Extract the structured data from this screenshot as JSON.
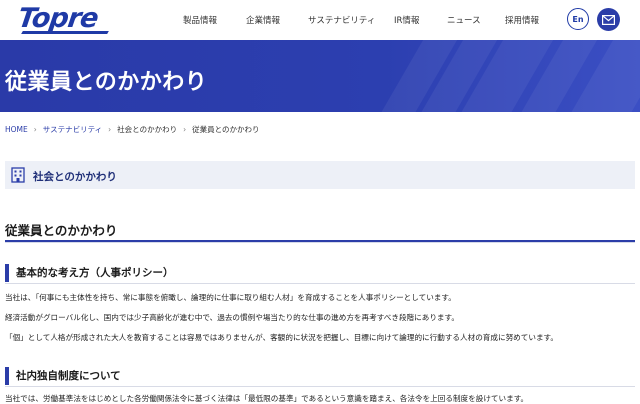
{
  "header": {
    "logo_text": "Topre",
    "nav": [
      "製品情報",
      "企業情報",
      "サステナビリティ",
      "IR情報",
      "ニュース",
      "採用情報"
    ],
    "lang_label": "En",
    "mail_icon": "mail-icon"
  },
  "hero": {
    "title": "従業員とのかかわり"
  },
  "breadcrumb": {
    "home": "HOME",
    "level1": "サステナビリティ",
    "level2": "社会とのかかわり",
    "current": "従業員とのかかわり"
  },
  "section": {
    "icon": "building-icon",
    "label": "社会とのかかわり"
  },
  "page_heading": "従業員とのかかわり",
  "policy": {
    "heading": "基本的な考え方（人事ポリシー）",
    "paragraphs": [
      "当社は、「何事にも主体性を持ち、常に事態を俯瞰し、論理的に仕事に取り組む人材」を育成することを人事ポリシーとしています。",
      "経済活動がグローバル化し、国内では少子高齢化が進む中で、過去の慣例や場当たり的な仕事の進め方を再考すべき段階にあります。",
      "「個」として人格が形成された大人を教育することは容易ではありませんが、客観的に状況を把握し、目標に向けて論理的に行動する人材の育成に努めています。"
    ]
  },
  "system": {
    "heading": "社内独自制度について",
    "paragraph": "当社では、労働基準法をはじめとした各労働関係法令に基づく法律は「最低限の基準」であるという意識を踏まえ、各法令を上回る制度を設けています。"
  },
  "colors": {
    "brand": "#2b3da8",
    "section_bg": "#edf0f7"
  }
}
